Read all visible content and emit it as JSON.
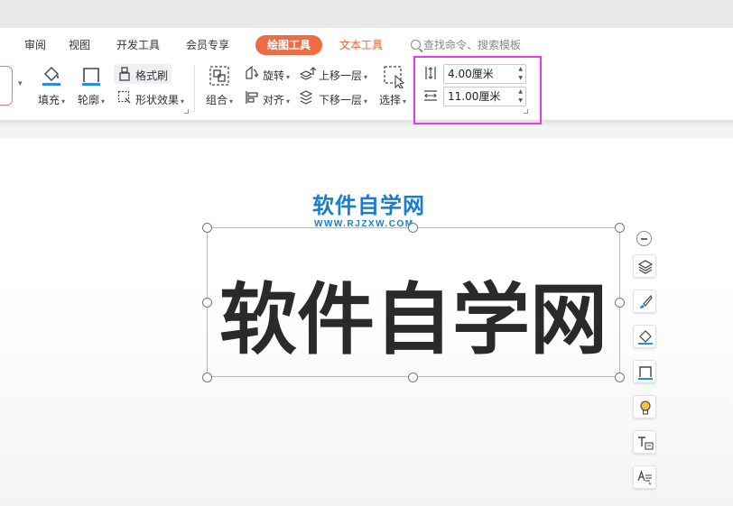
{
  "menubar": {
    "items": [
      "审阅",
      "视图",
      "开发工具",
      "会员专享"
    ],
    "active_tab": "绘图工具",
    "text_tool": "文本工具",
    "search_placeholder": "查找命令、搜索模板"
  },
  "toolbar": {
    "fill": "填充",
    "outline": "轮廓",
    "format_painter": "格式刷",
    "shape_effects": "形状效果",
    "group": "组合",
    "rotate": "旋转",
    "align": "对齐",
    "bring_forward": "上移一层",
    "send_backward": "下移一层",
    "select": "选择",
    "height_value": "4.00厘米",
    "width_value": "11.00厘米",
    "caret": "▾"
  },
  "canvas": {
    "logo_text": "软件自学网",
    "logo_url": "WWW.RJZXW.COM",
    "shape_text": "软件自学网"
  },
  "colors": {
    "accent_orange": "#ee6b43",
    "highlight_magenta": "#e43be4",
    "logo_blue": "#1a7ccf"
  }
}
